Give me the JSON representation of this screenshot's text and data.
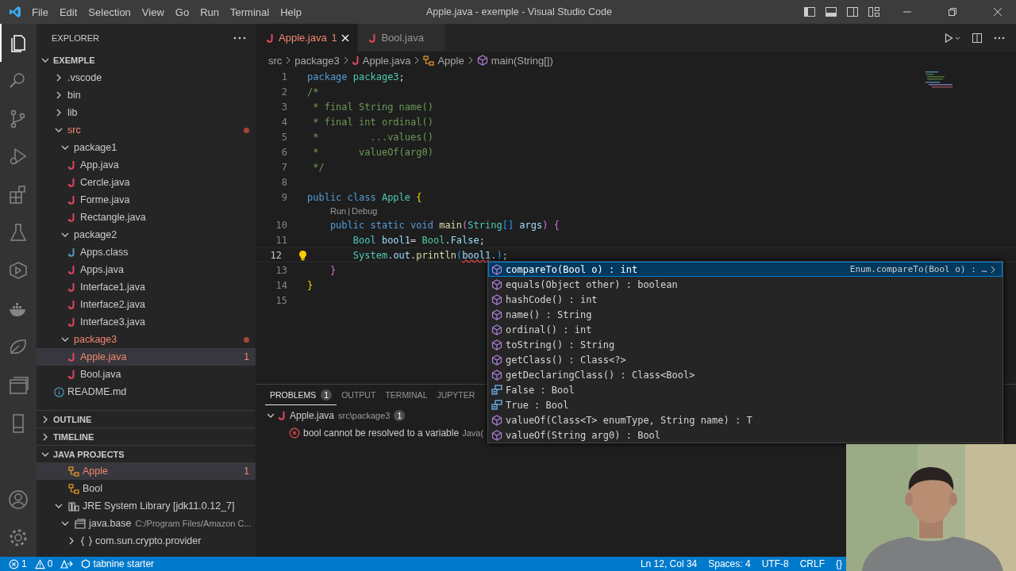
{
  "window": {
    "menu": [
      "File",
      "Edit",
      "Selection",
      "View",
      "Go",
      "Run",
      "Terminal",
      "Help"
    ],
    "title": "Apple.java - exemple - Visual Studio Code"
  },
  "activity_bar": [
    {
      "kind": "files",
      "selected": true
    },
    {
      "kind": "search",
      "selected": false
    },
    {
      "kind": "scm",
      "selected": false
    },
    {
      "kind": "debug",
      "selected": false
    },
    {
      "kind": "extensions",
      "selected": false
    },
    {
      "kind": "testing",
      "selected": false
    },
    {
      "kind": "remote",
      "selected": false
    },
    {
      "kind": "docker",
      "selected": false
    },
    {
      "kind": "leaf",
      "selected": false
    },
    {
      "kind": "windows",
      "selected": false
    },
    {
      "kind": "device",
      "selected": false
    }
  ],
  "sidebar": {
    "title": "EXPLORER",
    "root": "EXEMPLE",
    "tree": [
      {
        "label": ".vscode",
        "kind": "folder",
        "expanded": false,
        "error": false,
        "selected": false
      },
      {
        "label": "bin",
        "kind": "folder",
        "expanded": false,
        "error": false,
        "selected": false
      },
      {
        "label": "lib",
        "kind": "folder",
        "expanded": false,
        "error": false,
        "selected": false
      },
      {
        "label": "src",
        "kind": "folder",
        "expanded": true,
        "error": true,
        "selected": false,
        "children": [
          {
            "label": "package1",
            "kind": "folder",
            "expanded": true,
            "error": false,
            "selected": false,
            "children": [
              {
                "label": "App.java",
                "kind": "java",
                "error": false,
                "selected": false
              },
              {
                "label": "Cercle.java",
                "kind": "java",
                "error": false,
                "selected": false
              },
              {
                "label": "Forme.java",
                "kind": "java",
                "error": false,
                "selected": false
              },
              {
                "label": "Rectangle.java",
                "kind": "java",
                "error": false,
                "selected": false
              }
            ]
          },
          {
            "label": "package2",
            "kind": "folder",
            "expanded": true,
            "error": false,
            "selected": false,
            "children": [
              {
                "label": "Apps.class",
                "kind": "classfile",
                "error": false,
                "selected": false
              },
              {
                "label": "Apps.java",
                "kind": "java",
                "error": false,
                "selected": false
              },
              {
                "label": "Interface1.java",
                "kind": "java",
                "error": false,
                "selected": false
              },
              {
                "label": "Interface2.java",
                "kind": "java",
                "error": false,
                "selected": false
              },
              {
                "label": "Interface3.java",
                "kind": "java",
                "error": false,
                "selected": false
              }
            ]
          },
          {
            "label": "package3",
            "kind": "folder",
            "expanded": true,
            "error": true,
            "selected": false,
            "children": [
              {
                "label": "Apple.java",
                "kind": "java",
                "error": true,
                "selected": true,
                "badge": "1"
              },
              {
                "label": "Bool.java",
                "kind": "java",
                "error": false,
                "selected": false
              }
            ]
          }
        ]
      },
      {
        "label": "README.md",
        "kind": "info",
        "error": false,
        "selected": false
      }
    ],
    "sections": [
      {
        "title": "OUTLINE",
        "expanded": false
      },
      {
        "title": "TIMELINE",
        "expanded": false
      },
      {
        "title": "JAVA PROJECTS",
        "expanded": true,
        "items": [
          {
            "label": "Apple",
            "kind": "type",
            "error": true,
            "selected": true,
            "badge": "1"
          },
          {
            "label": "Bool",
            "kind": "type",
            "error": false,
            "selected": false
          },
          {
            "label": "JRE System Library [jdk11.0.12_7]",
            "kind": "library",
            "expanded": true,
            "error": false,
            "selected": false,
            "children": [
              {
                "label": "java.base",
                "description": "C:/Program Files/Amazon C...",
                "kind": "module",
                "expanded": true,
                "error": false,
                "selected": false,
                "children": [
                  {
                    "label": "com.sun.crypto.provider",
                    "kind": "package",
                    "expanded": false,
                    "error": false,
                    "selected": false
                  }
                ]
              }
            ]
          }
        ]
      }
    ]
  },
  "tabs": [
    {
      "label": "Apple.java",
      "selected": true,
      "error": true,
      "badge": "1"
    },
    {
      "label": "Bool.java",
      "selected": false,
      "error": false
    }
  ],
  "breadcrumb": [
    {
      "label": "src",
      "kind": "folder"
    },
    {
      "label": "package3",
      "kind": "folder"
    },
    {
      "label": "Apple.java",
      "kind": "java"
    },
    {
      "label": "Apple",
      "kind": "class"
    },
    {
      "label": "main(String[])",
      "kind": "method"
    }
  ],
  "editor": {
    "lines": [
      {
        "kind": "code",
        "number": "1",
        "current": false,
        "tokens": [
          {
            "text": "package ",
            "kind": "kw"
          },
          {
            "text": "package3",
            "kind": "type"
          },
          {
            "text": ";",
            "kind": "plain"
          }
        ]
      },
      {
        "kind": "code",
        "number": "2",
        "current": false,
        "tokens": [
          {
            "text": "/*",
            "kind": "comment"
          }
        ]
      },
      {
        "kind": "code",
        "number": "3",
        "current": false,
        "tokens": [
          {
            "text": " * final String name()",
            "kind": "comment"
          }
        ]
      },
      {
        "kind": "code",
        "number": "4",
        "current": false,
        "tokens": [
          {
            "text": " * final int ordinal()",
            "kind": "comment"
          }
        ]
      },
      {
        "kind": "code",
        "number": "5",
        "current": false,
        "tokens": [
          {
            "text": " *         ...values()",
            "kind": "comment"
          }
        ]
      },
      {
        "kind": "code",
        "number": "6",
        "current": false,
        "tokens": [
          {
            "text": " *       valueOf(arg0)",
            "kind": "comment"
          }
        ]
      },
      {
        "kind": "code",
        "number": "7",
        "current": false,
        "tokens": [
          {
            "text": " */",
            "kind": "comment"
          }
        ]
      },
      {
        "kind": "code",
        "number": "8",
        "current": false
      },
      {
        "kind": "code",
        "number": "9",
        "current": false,
        "tokens": [
          {
            "text": "public class ",
            "kind": "kw"
          },
          {
            "text": "Apple ",
            "kind": "type"
          },
          {
            "text": "{",
            "kind": "b1"
          }
        ]
      },
      {
        "kind": "lens",
        "parts": [
          "Run",
          "|",
          "Debug"
        ]
      },
      {
        "kind": "code",
        "number": "10",
        "current": false,
        "tokens": [
          {
            "text": "    public static void ",
            "kind": "kw"
          },
          {
            "text": "main",
            "kind": "fn"
          },
          {
            "text": "(",
            "kind": "b2"
          },
          {
            "text": "String",
            "kind": "type"
          },
          {
            "text": "[] ",
            "kind": "b3"
          },
          {
            "text": "args",
            "kind": "var"
          },
          {
            "text": ") ",
            "kind": "b2"
          },
          {
            "text": "{",
            "kind": "b2"
          }
        ]
      },
      {
        "kind": "code",
        "number": "11",
        "current": false,
        "tokens": [
          {
            "text": "        Bool ",
            "kind": "type"
          },
          {
            "text": "bool1",
            "kind": "var"
          },
          {
            "text": "= ",
            "kind": "plain"
          },
          {
            "text": "Bool",
            "kind": "type"
          },
          {
            "text": ".",
            "kind": "plain"
          },
          {
            "text": "False",
            "kind": "var"
          },
          {
            "text": ";",
            "kind": "plain"
          }
        ]
      },
      {
        "kind": "code",
        "number": "12",
        "current": true,
        "tokens": [
          {
            "text": "        System",
            "kind": "type"
          },
          {
            "text": ".",
            "kind": "plain"
          },
          {
            "text": "out",
            "kind": "var"
          },
          {
            "text": ".",
            "kind": "plain"
          },
          {
            "text": "println",
            "kind": "fn"
          },
          {
            "text": "(",
            "kind": "b3"
          },
          {
            "text": "bool1",
            "kind": "error"
          },
          {
            "text": ".",
            "kind": "plain"
          },
          {
            "text": ")",
            "kind": "b3"
          },
          {
            "text": ";",
            "kind": "plain"
          }
        ]
      },
      {
        "kind": "code",
        "number": "13",
        "current": false,
        "tokens": [
          {
            "text": "    }",
            "kind": "b2"
          }
        ]
      },
      {
        "kind": "code",
        "number": "14",
        "current": false,
        "tokens": [
          {
            "text": "}",
            "kind": "b1"
          }
        ]
      },
      {
        "kind": "code",
        "number": "15",
        "current": false
      }
    ]
  },
  "suggestions": [
    {
      "label": "compareTo(Bool o) : int",
      "kind": "method",
      "selected": true,
      "detail": "Enum.compareTo(Bool o) : …"
    },
    {
      "label": "equals(Object other) : boolean",
      "kind": "method",
      "selected": false
    },
    {
      "label": "hashCode() : int",
      "kind": "method",
      "selected": false
    },
    {
      "label": "name() : String",
      "kind": "method",
      "selected": false
    },
    {
      "label": "ordinal() : int",
      "kind": "method",
      "selected": false
    },
    {
      "label": "toString() : String",
      "kind": "method",
      "selected": false
    },
    {
      "label": "getClass() : Class<?>",
      "kind": "method",
      "selected": false
    },
    {
      "label": "getDeclaringClass() : Class<Bool>",
      "kind": "method",
      "selected": false
    },
    {
      "label": "False : Bool",
      "kind": "enum",
      "selected": false
    },
    {
      "label": "True : Bool",
      "kind": "enum",
      "selected": false
    },
    {
      "label": "valueOf(Class<T> enumType, String name) : T",
      "kind": "method",
      "selected": false
    },
    {
      "label": "valueOf(String arg0) : Bool",
      "kind": "method",
      "selected": false
    }
  ],
  "panel": {
    "tabs": [
      {
        "label": "PROBLEMS",
        "selected": true,
        "badge": "1"
      },
      {
        "label": "OUTPUT",
        "selected": false
      },
      {
        "label": "TERMINAL",
        "selected": false
      },
      {
        "label": "JUPYTER",
        "selected": false
      }
    ],
    "problems": [
      {
        "file": "Apple.java",
        "path": "src\\package3",
        "count": "1",
        "expanded": true,
        "messages": [
          {
            "text": "bool cannot be resolved to a variable",
            "source": "Java("
          }
        ]
      }
    ]
  },
  "status_bar": {
    "left": [
      {
        "kind": "errors",
        "text": "1"
      },
      {
        "kind": "warnings",
        "text": "0"
      },
      {
        "kind": "liveshare"
      },
      {
        "kind": "tabnine",
        "text": "tabnine starter"
      }
    ],
    "right": [
      "Ln 12, Col 34",
      "Spaces: 4",
      "UTF-8",
      "CRLF",
      "{}"
    ]
  }
}
